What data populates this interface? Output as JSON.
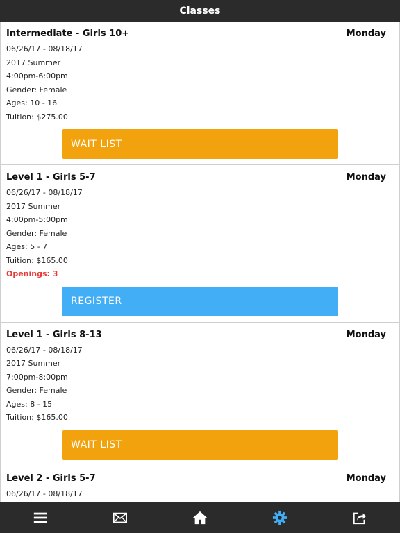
{
  "header": {
    "title": "Classes"
  },
  "classes": [
    {
      "name": "Intermediate - Girls 10+",
      "day": "Monday",
      "dates": "06/26/17 - 08/18/17",
      "session": "2017 Summer",
      "time": "4:00pm-6:00pm",
      "gender": "Gender: Female",
      "ages": "Ages: 10 - 16",
      "tuition": "Tuition: $275.00",
      "button": "WAIT LIST"
    },
    {
      "name": "Level 1 - Girls 5-7",
      "day": "Monday",
      "dates": "06/26/17 - 08/18/17",
      "session": "2017 Summer",
      "time": "4:00pm-5:00pm",
      "gender": "Gender: Female",
      "ages": "Ages: 5 - 7",
      "tuition": "Tuition: $165.00",
      "openings": "Openings: 3",
      "button": "REGISTER"
    },
    {
      "name": "Level 1 - Girls 8-13",
      "day": "Monday",
      "dates": "06/26/17 - 08/18/17",
      "session": "2017 Summer",
      "time": "7:00pm-8:00pm",
      "gender": "Gender: Female",
      "ages": "Ages: 8 - 15",
      "tuition": "Tuition: $165.00",
      "button": "WAIT LIST"
    },
    {
      "name": "Level 2 - Girls 5-7",
      "day": "Monday",
      "dates": "06/26/17 - 08/18/17"
    }
  ],
  "colors": {
    "waitlist": "#f2a20c",
    "register": "#42aef5",
    "openings": "#e53935",
    "bar": "#2b2b2b",
    "active_tab": "#42aef5"
  },
  "tabbar": {
    "items": [
      {
        "icon": "menu-icon"
      },
      {
        "icon": "mail-icon"
      },
      {
        "icon": "home-icon"
      },
      {
        "icon": "gear-icon",
        "active": true
      },
      {
        "icon": "share-icon"
      }
    ]
  }
}
